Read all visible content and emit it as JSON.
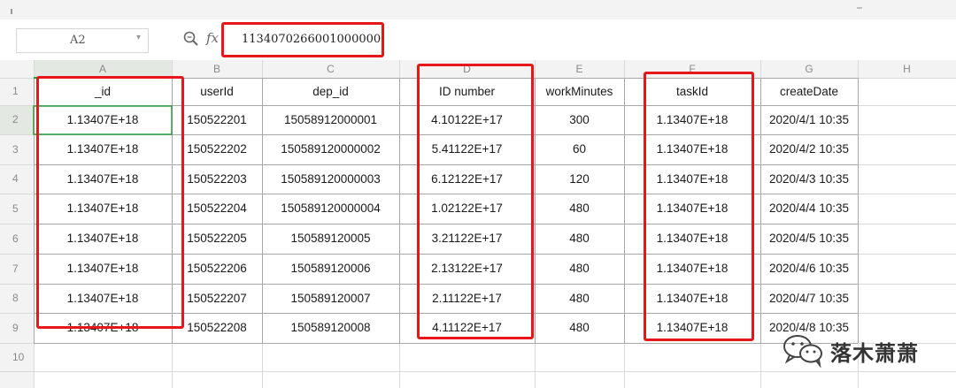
{
  "formula_bar": {
    "name_box": "A2",
    "fx_label": "fx",
    "formula_value": "1134070266001000000"
  },
  "column_headers": [
    "A",
    "B",
    "C",
    "D",
    "E",
    "F",
    "G",
    "H"
  ],
  "row_headers": [
    "1",
    "2",
    "3",
    "4",
    "5",
    "6",
    "7",
    "8",
    "9",
    "10"
  ],
  "table": {
    "headers": [
      "_id",
      "userId",
      "dep_id",
      "ID number",
      "workMinutes",
      "taskId",
      "createDate"
    ],
    "rows": [
      [
        "1.13407E+18",
        "150522201",
        "15058912000001",
        "4.10122E+17",
        "300",
        "1.13407E+18",
        "2020/4/1 10:35"
      ],
      [
        "1.13407E+18",
        "150522202",
        "150589120000002",
        "5.41122E+17",
        "60",
        "1.13407E+18",
        "2020/4/2 10:35"
      ],
      [
        "1.13407E+18",
        "150522203",
        "150589120000003",
        "6.12122E+17",
        "120",
        "1.13407E+18",
        "2020/4/3 10:35"
      ],
      [
        "1.13407E+18",
        "150522204",
        "150589120000004",
        "1.02122E+17",
        "480",
        "1.13407E+18",
        "2020/4/4 10:35"
      ],
      [
        "1.13407E+18",
        "150522205",
        "150589120005",
        "3.21122E+17",
        "480",
        "1.13407E+18",
        "2020/4/5 10:35"
      ],
      [
        "1.13407E+18",
        "150522206",
        "150589120006",
        "2.13122E+17",
        "480",
        "1.13407E+18",
        "2020/4/6 10:35"
      ],
      [
        "1.13407E+18",
        "150522207",
        "150589120007",
        "2.11122E+17",
        "480",
        "1.13407E+18",
        "2020/4/7 10:35"
      ],
      [
        "1.13407E+18",
        "150522208",
        "150589120008",
        "4.11122E+17",
        "480",
        "1.13407E+18",
        "2020/4/8 10:35"
      ]
    ]
  },
  "watermark": {
    "text": "落木萧萧",
    "icon": "wechat-icon"
  },
  "colors": {
    "highlight_red": "#e8151b",
    "selected_green": "#2e9e44",
    "grid_line": "#d9d9d9",
    "header_bg": "#f3f3f3"
  }
}
